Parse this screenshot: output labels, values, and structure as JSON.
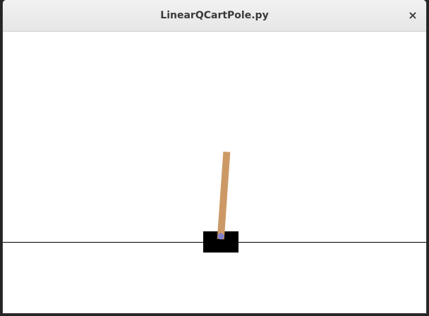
{
  "window": {
    "title": "LinearQCartPole.py",
    "close_label": "×"
  },
  "scene": {
    "pole_angle_deg": 4,
    "colors": {
      "track": "#000000",
      "cart": "#000000",
      "pole": "#cc9966",
      "axle": "#8080cc",
      "background": "#ffffff"
    }
  }
}
